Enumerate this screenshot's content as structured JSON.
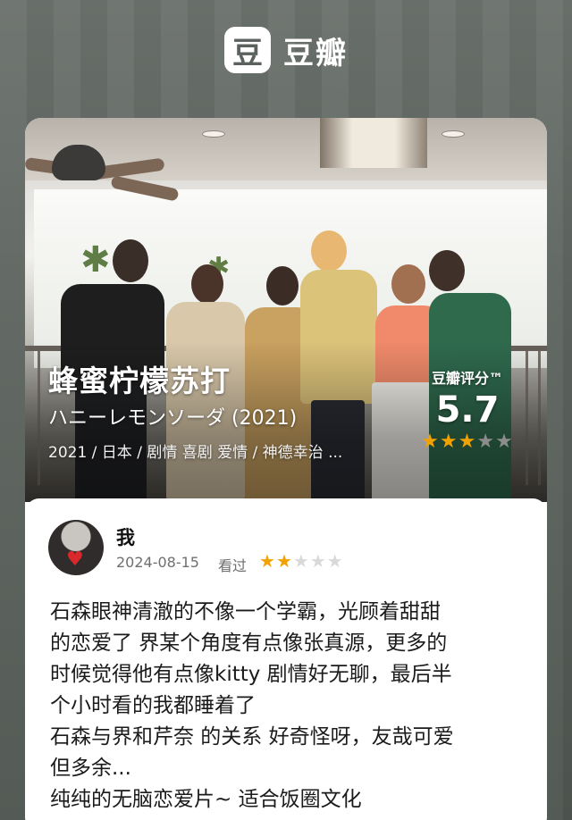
{
  "brand": {
    "logo_char": "豆",
    "name": "豆瓣"
  },
  "movie": {
    "title": "蜂蜜柠檬苏打",
    "original_title": "ハニーレモンソーダ (2021)",
    "meta": "2021 / 日本 / 剧情 喜剧 爱情 / 神德幸治 ...",
    "score_label": "豆瓣评分™",
    "score": "5.7",
    "score_stars": 3,
    "score_stars_max": 5
  },
  "review": {
    "user_name": "我",
    "date": "2024-08-15",
    "status": "看过",
    "rating": 2,
    "rating_max": 5,
    "lines": [
      "石森眼神清澈的不像一个学霸，光顾着甜甜",
      "的恋爱了 界某个角度有点像张真源，更多的",
      "时候觉得他有点像kitty 剧情好无聊，最后半",
      "个小时看的我都睡着了",
      "石森与界和芹奈 的关系 好奇怪呀，友哉可爱",
      "但多余...",
      "纯纯的无脑恋爱片~ 适合饭圈文化"
    ]
  },
  "colors": {
    "star_on": "#f2a200",
    "star_off": "#d9d9d9",
    "page_bg": "#5b625d"
  }
}
